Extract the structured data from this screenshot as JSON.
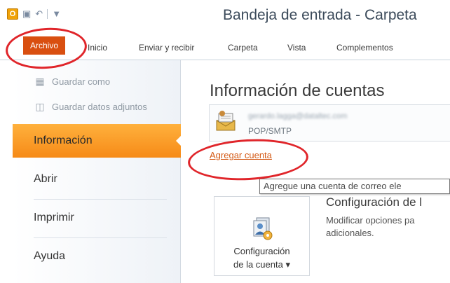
{
  "window": {
    "title": "Bandeja de entrada - Carpeta",
    "app_icon_label": "O"
  },
  "quick_access": {
    "icons": [
      "save-icon",
      "undo-icon",
      "customize-icon"
    ]
  },
  "ribbon": {
    "tabs": [
      {
        "id": "archivo",
        "label": "Archivo",
        "selected": true
      },
      {
        "id": "inicio",
        "label": "Inicio"
      },
      {
        "id": "enviar-recibir",
        "label": "Enviar y recibir"
      },
      {
        "id": "carpeta",
        "label": "Carpeta"
      },
      {
        "id": "vista",
        "label": "Vista"
      },
      {
        "id": "complementos",
        "label": "Complementos"
      }
    ],
    "file_tab_color": "#d94f10"
  },
  "sidebar": {
    "commands": [
      {
        "label": "Guardar como",
        "icon": "save-as-icon"
      },
      {
        "label": "Guardar datos adjuntos",
        "icon": "attachments-icon"
      }
    ],
    "items": [
      {
        "label": "Información",
        "selected": true
      },
      {
        "label": "Abrir"
      },
      {
        "label": "Imprimir"
      },
      {
        "label": "Ayuda"
      }
    ],
    "selected_color": "#f68a17"
  },
  "main": {
    "title": "Información de cuentas",
    "account": {
      "email": "gerardo.lagga@dataltec.com",
      "type": "POP/SMTP",
      "icon": "mail-account-icon"
    },
    "add_account_label": "Agregar cuenta",
    "tooltip": "Agregue una cuenta de correo ele",
    "account_settings": {
      "button_line1": "Configuración",
      "button_line2": "de la cuenta ▾",
      "icon": "account-settings-icon",
      "section_title": "Configuración de l",
      "section_desc_line1": "Modificar opciones pa",
      "section_desc_line2": "adicionales."
    }
  },
  "annotations": {
    "color": "#e0252a"
  }
}
